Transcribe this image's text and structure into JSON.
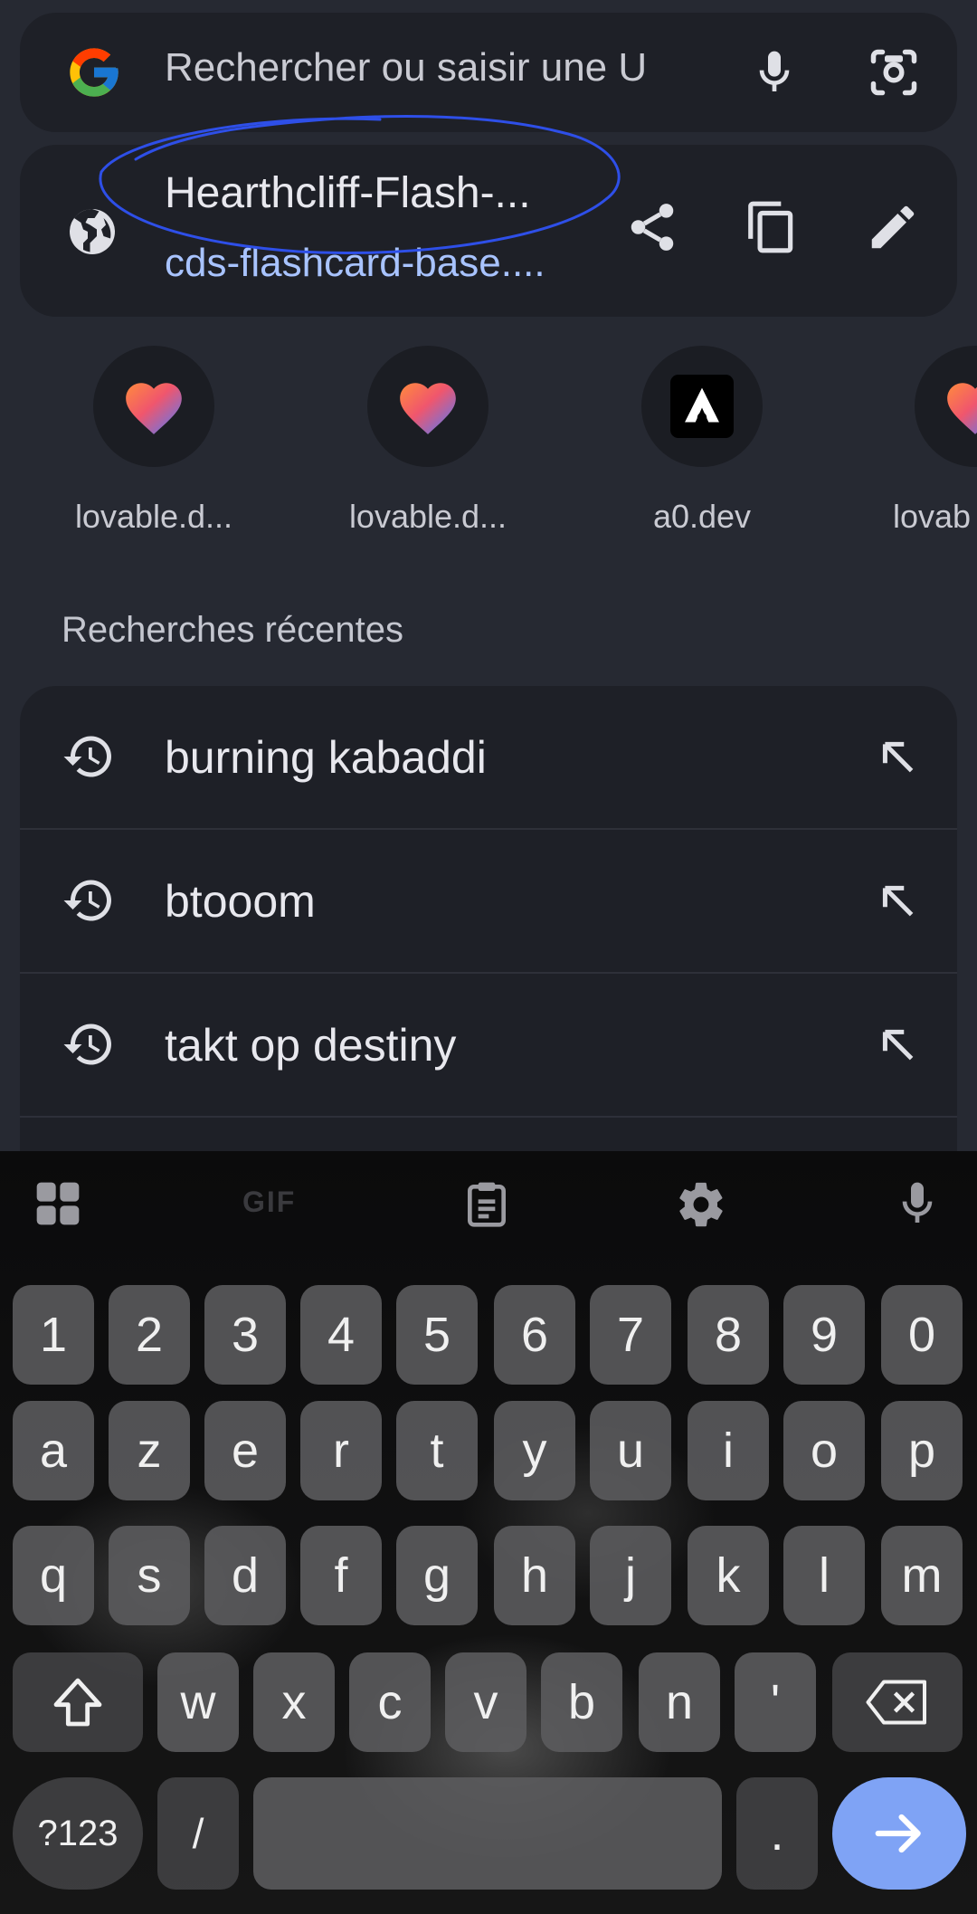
{
  "search": {
    "placeholder_text": "Rechercher ou saisir une U"
  },
  "current_page": {
    "title": "Hearthcliff-Flash-...",
    "url": "cds-flashcard-base...."
  },
  "shortcuts": [
    {
      "label": "lovable.d...",
      "icon": "lovable-heart-icon"
    },
    {
      "label": "lovable.d...",
      "icon": "lovable-heart-icon"
    },
    {
      "label": "a0.dev",
      "icon": "a0-dev-icon"
    },
    {
      "label": "lovab",
      "icon": "lovable-heart-icon"
    }
  ],
  "recent": {
    "title": "Recherches récentes",
    "items": [
      {
        "text": "burning kabaddi"
      },
      {
        "text": "btooom"
      },
      {
        "text": "takt op destiny"
      }
    ]
  },
  "keyboard": {
    "toolbar": [
      "apps-grid-icon",
      "GIF",
      "clipboard-icon",
      "settings-gear-icon",
      "mic-icon"
    ],
    "rows": [
      [
        "1",
        "2",
        "3",
        "4",
        "5",
        "6",
        "7",
        "8",
        "9",
        "0"
      ],
      [
        "a",
        "z",
        "e",
        "r",
        "t",
        "y",
        "u",
        "i",
        "o",
        "p"
      ],
      [
        "q",
        "s",
        "d",
        "f",
        "g",
        "h",
        "j",
        "k",
        "l",
        "m"
      ],
      [
        "w",
        "x",
        "c",
        "v",
        "b",
        "n",
        "'"
      ]
    ],
    "symbols_label": "?123",
    "slash_label": "/",
    "period_label": "."
  },
  "colors": {
    "background": "#262932",
    "card": "#1e2027",
    "link": "#a8c3ff",
    "annotation": "#2e4fe8",
    "enter_key": "#7fa3f5"
  }
}
